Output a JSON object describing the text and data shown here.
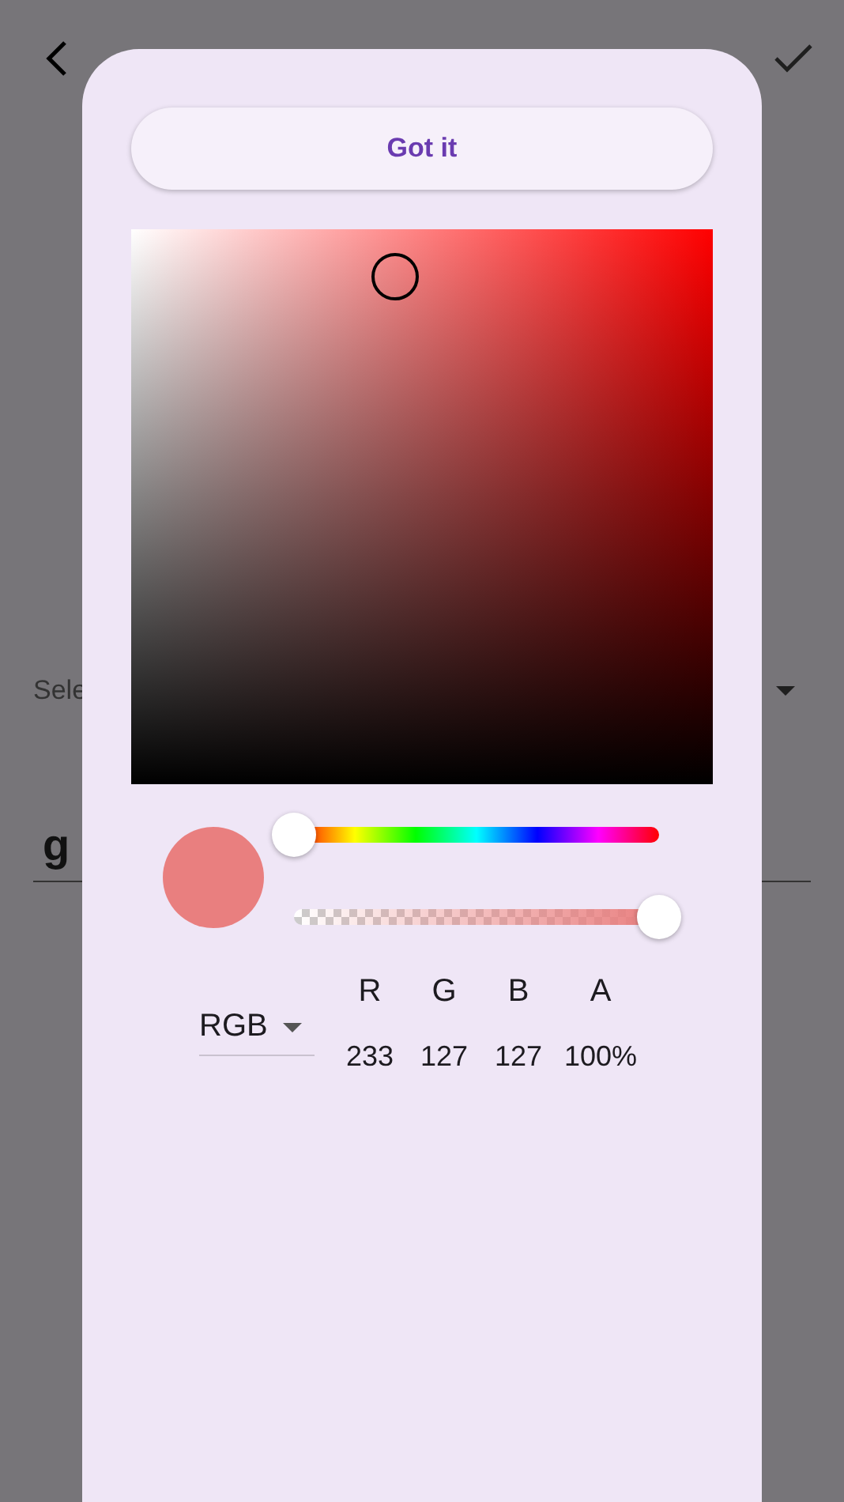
{
  "form": {
    "select_field": {
      "label": "Sele"
    },
    "text_field": {
      "value": "g"
    }
  },
  "dialog": {
    "button": "Got it",
    "picker": {
      "hue_slider": {
        "level": 0
      },
      "alpha_slider": {
        "level": 1
      },
      "mode": "RGB",
      "channels": [
        {
          "label": "R",
          "value": "233"
        },
        {
          "label": "G",
          "value": "127"
        },
        {
          "label": "B",
          "value": "127"
        },
        {
          "label": "A",
          "value": "100%"
        }
      ]
    }
  }
}
